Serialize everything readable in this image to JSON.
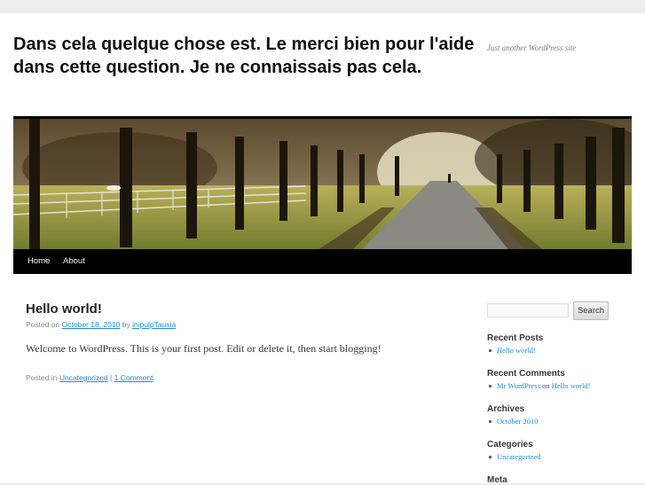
{
  "site": {
    "title": "Dans cela quelque chose est. Le merci bien pour l'aide dans cette question. Je ne connaissais pas cela.",
    "description": "Just another WordPress site"
  },
  "nav": {
    "items": [
      {
        "label": "Home"
      },
      {
        "label": "About"
      }
    ]
  },
  "post": {
    "title": "Hello world!",
    "meta": {
      "posted_on": "Posted on",
      "date": "October 18, 2010",
      "by": "by",
      "author": "inipulpTausia"
    },
    "body": "Welcome to WordPress. This is your first post. Edit or delete it, then start blogging!",
    "footer": {
      "posted_in": "Posted in",
      "category": "Uncategorized",
      "separator": "|",
      "comments": "1 Comment"
    }
  },
  "sidebar": {
    "search": {
      "placeholder": "",
      "button": "Search"
    },
    "recent_posts": {
      "title": "Recent Posts",
      "items": [
        "Hello world!"
      ]
    },
    "recent_comments": {
      "title": "Recent Comments",
      "items": [
        {
          "author": "Mr WordPress",
          "on": "on",
          "post": "Hello world!"
        }
      ]
    },
    "archives": {
      "title": "Archives",
      "items": [
        "October 2010"
      ]
    },
    "categories": {
      "title": "Categories",
      "items": [
        "Uncategorized"
      ]
    },
    "meta": {
      "title": "Meta"
    }
  },
  "colors": {
    "link": "#1b8be0",
    "nav_background": "#000000",
    "page_background": "#ededed"
  }
}
